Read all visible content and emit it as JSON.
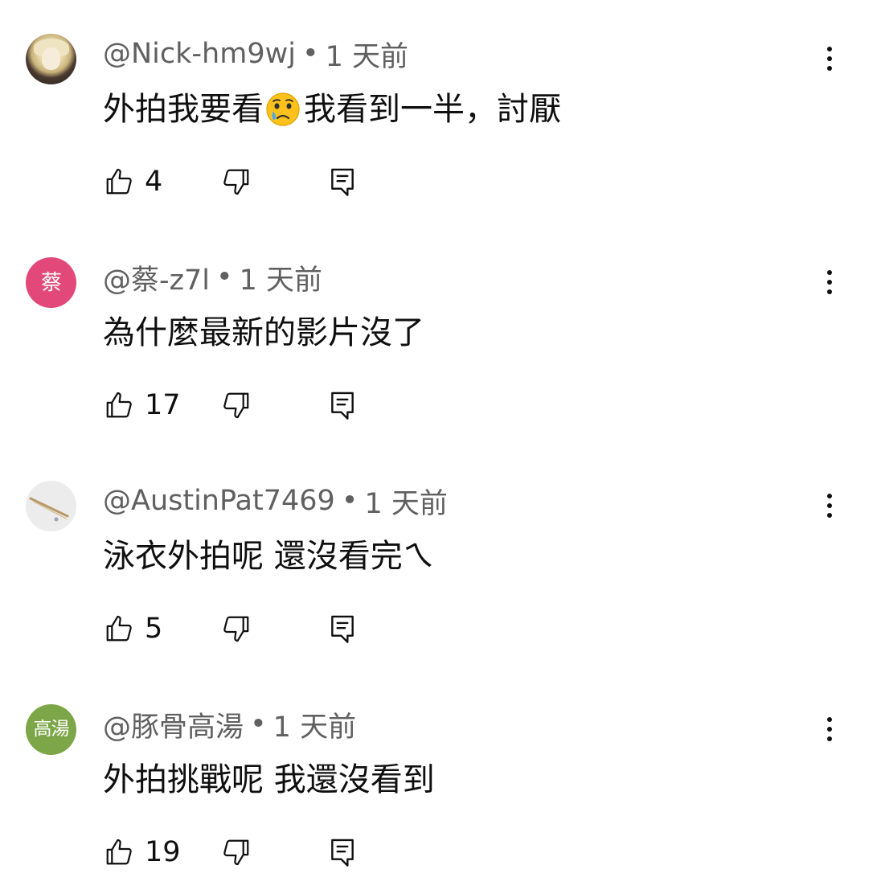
{
  "comments": [
    {
      "author": "@Nick-hm9wj",
      "separator": "•",
      "time": "1 天前",
      "text_before_emoji": "外拍我要看",
      "emoji": "crying-face",
      "text_after_emoji": "我看到一半，討厭",
      "likes": "4",
      "avatar_type": "photo",
      "avatar_label": ""
    },
    {
      "author": "@蔡-z7l",
      "separator": "•",
      "time": "1 天前",
      "text": "為什麼最新的影片沒了",
      "likes": "17",
      "avatar_type": "letter",
      "avatar_label": "蔡",
      "avatar_color": "#e2487a"
    },
    {
      "author": "@AustinPat7469",
      "separator": "•",
      "time": "1 天前",
      "text": "泳衣外拍呢 還沒看完ㄟ",
      "likes": "5",
      "avatar_type": "photo",
      "avatar_label": ""
    },
    {
      "author": "@豚骨高湯",
      "separator": "•",
      "time": "1 天前",
      "text": "外拍挑戰呢 我還沒看到",
      "likes": "19",
      "avatar_type": "letter",
      "avatar_label": "高湯",
      "avatar_color": "#7ca647"
    }
  ],
  "icons": {
    "like": "thumb-up-icon",
    "dislike": "thumb-down-icon",
    "reply": "reply-comment-icon",
    "menu": "more-vert-icon"
  },
  "colors": {
    "text_primary": "#0f0f0f",
    "text_secondary": "#606060",
    "background": "#ffffff"
  }
}
